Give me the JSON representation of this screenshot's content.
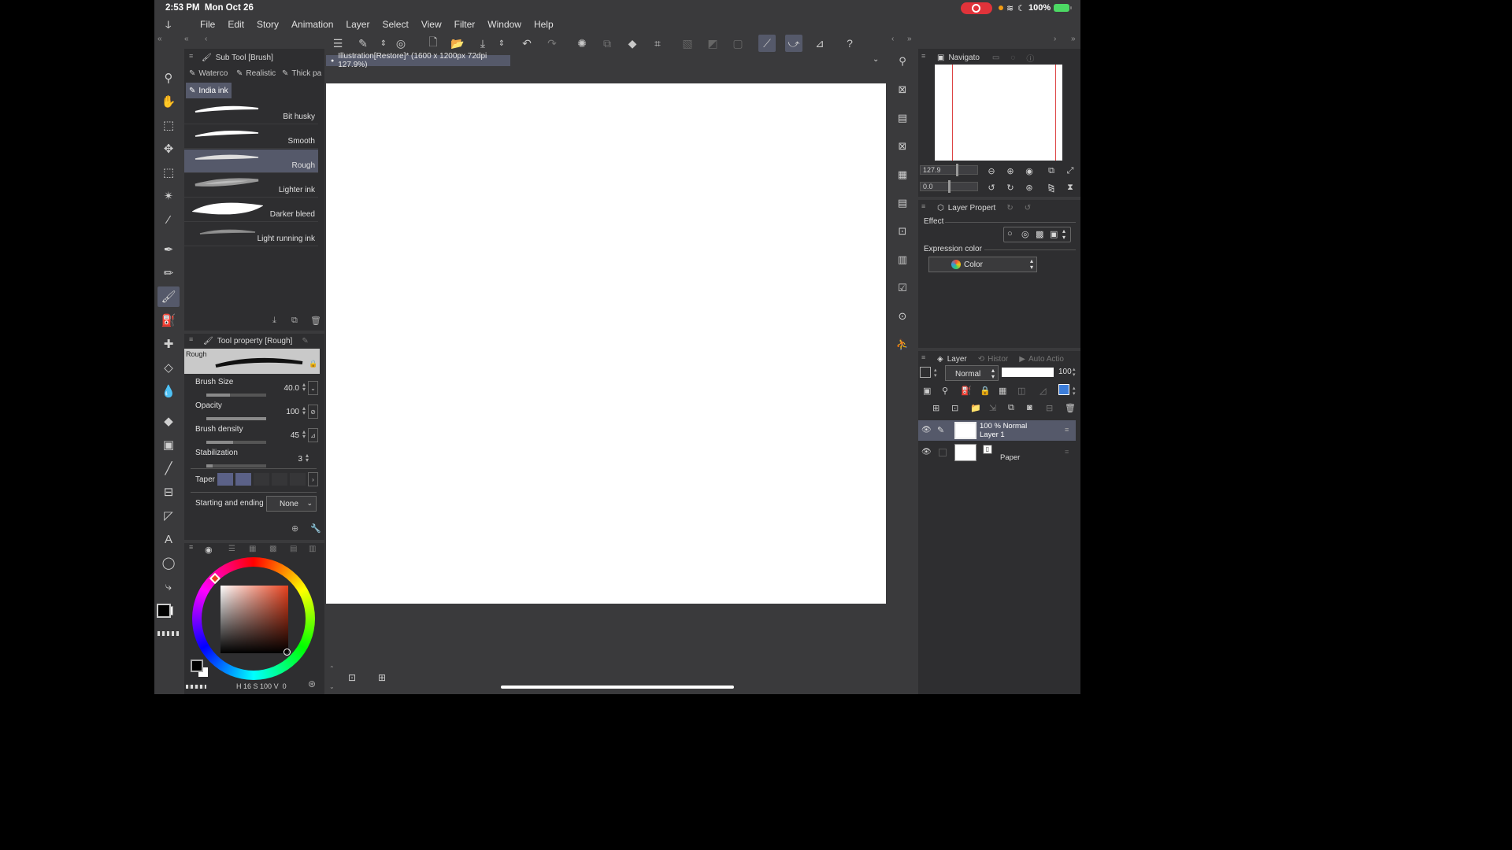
{
  "status": {
    "time": "2:53 PM",
    "date": "Mon Oct 26",
    "battery": "100%"
  },
  "menu": [
    "File",
    "Edit",
    "Story",
    "Animation",
    "Layer",
    "Select",
    "View",
    "Filter",
    "Window",
    "Help"
  ],
  "subtool_panel": {
    "title": "Sub Tool [Brush]",
    "tabs": [
      "Waterco",
      "Realistic",
      "Thick pa",
      "India ink"
    ],
    "brushes": [
      "Bit husky",
      "Smooth",
      "Rough",
      "Lighter ink",
      "Darker bleed",
      "Light running ink"
    ]
  },
  "tool_property": {
    "title": "Tool property [Rough]",
    "preview_label": "Rough",
    "brush_size_label": "Brush Size",
    "brush_size": "40.0",
    "brush_size_fraction": 0.4,
    "opacity_label": "Opacity",
    "opacity": "100",
    "opacity_fraction": 1.0,
    "brush_density_label": "Brush density",
    "brush_density": "45",
    "brush_density_fraction": 0.45,
    "stabilization_label": "Stabilization",
    "stabilization": "3",
    "stabilization_fraction": 0.1,
    "taper_label": "Taper",
    "starting_ending_label": "Starting and ending",
    "starting_ending_value": "None"
  },
  "color_footer": {
    "value1": "16",
    "value2": "100",
    "value3": "0"
  },
  "document": {
    "tab": "Illustration[Restore]* (1600 x 1200px 72dpi 127.9%)"
  },
  "navigator": {
    "title": "Navigato",
    "zoom": "127.9",
    "rotation": "0.0"
  },
  "layer_property": {
    "title": "Layer Propert",
    "effect_label": "Effect",
    "expression_color_label": "Expression color",
    "expression_color_value": "Color"
  },
  "layer_panel": {
    "tabs": [
      "Layer",
      "Histor",
      "Auto Actio"
    ],
    "blend_mode": "Normal",
    "opacity": "100",
    "layers": [
      {
        "opacity_mode": "100 % Normal",
        "name": "Layer 1"
      },
      {
        "name": "Paper"
      }
    ]
  },
  "colors": {
    "accent": "#55596a",
    "panel": "#2e2e30",
    "app": "#3a3a3c",
    "record": "#e0333a",
    "battery": "#4cd964"
  }
}
